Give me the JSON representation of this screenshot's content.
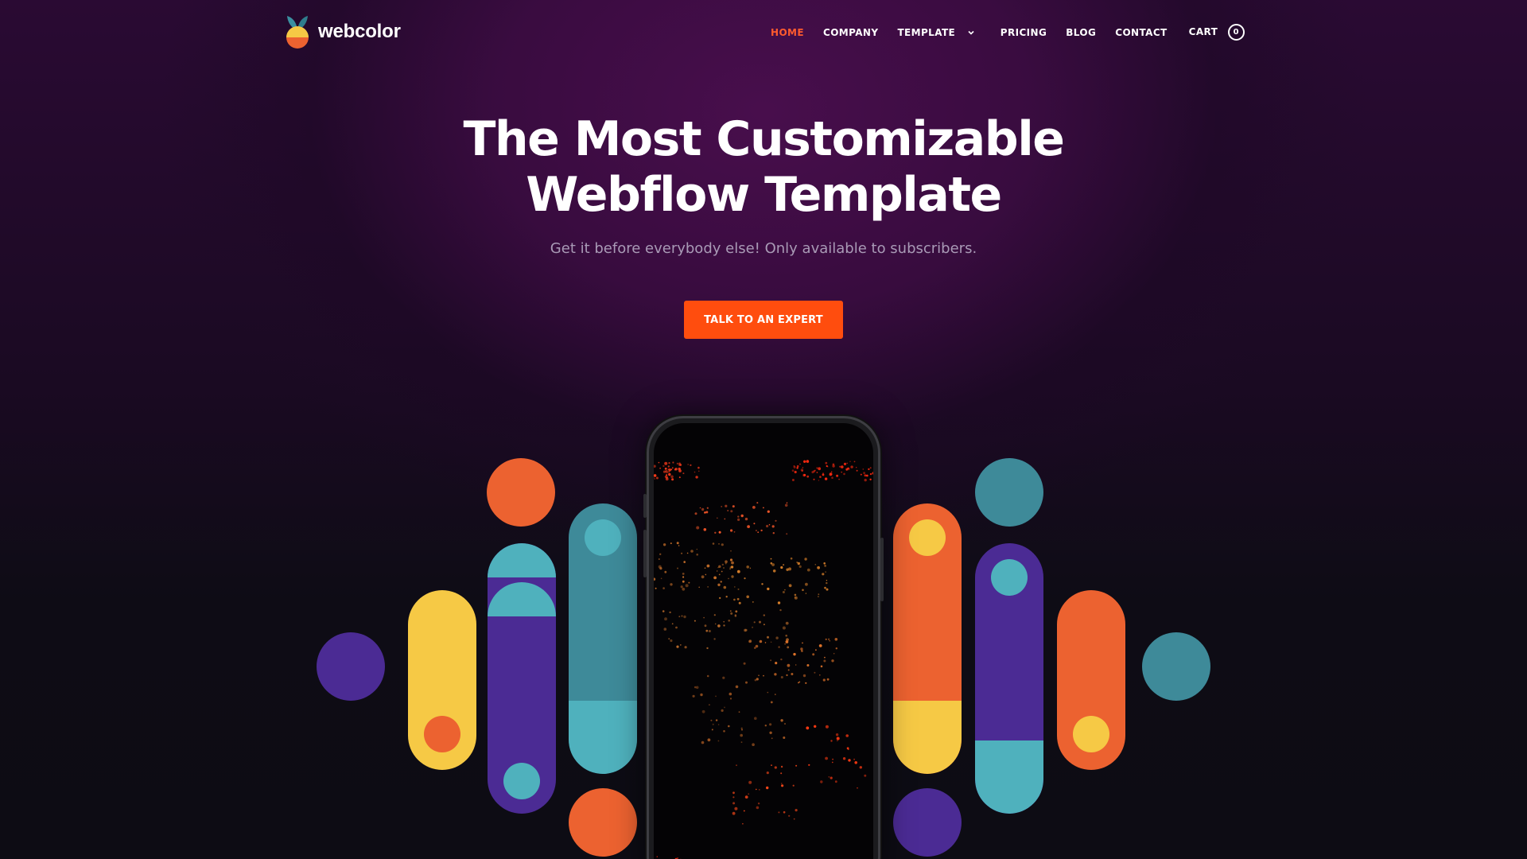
{
  "brand": {
    "name": "webcolor"
  },
  "nav": {
    "items": [
      {
        "label": "HOME",
        "active": true
      },
      {
        "label": "COMPANY"
      },
      {
        "label": "TEMPLATE",
        "dropdown": true
      },
      {
        "label": "PRICING"
      },
      {
        "label": "BLOG"
      },
      {
        "label": "CONTACT"
      }
    ],
    "cart_label": "CART",
    "cart_count": "0"
  },
  "hero": {
    "title_line1": "The Most Customizable",
    "title_line2": "Webflow Template",
    "subtitle": "Get it before everybody else! Only available to subscribers.",
    "cta_label": "TALK TO AN EXPERT"
  },
  "colors": {
    "accent": "#ff4d0e",
    "nav_active": "#ff5b2e",
    "orange": "#ec6230",
    "yellow": "#f6c945",
    "purple": "#4b2b94",
    "teal": "#3e8a99",
    "teal_light": "#4fb1bd",
    "background": "#0d0b14"
  },
  "icons": {
    "dropdown": "chevron-down-icon",
    "logo": "leaf-fruit-icon"
  }
}
